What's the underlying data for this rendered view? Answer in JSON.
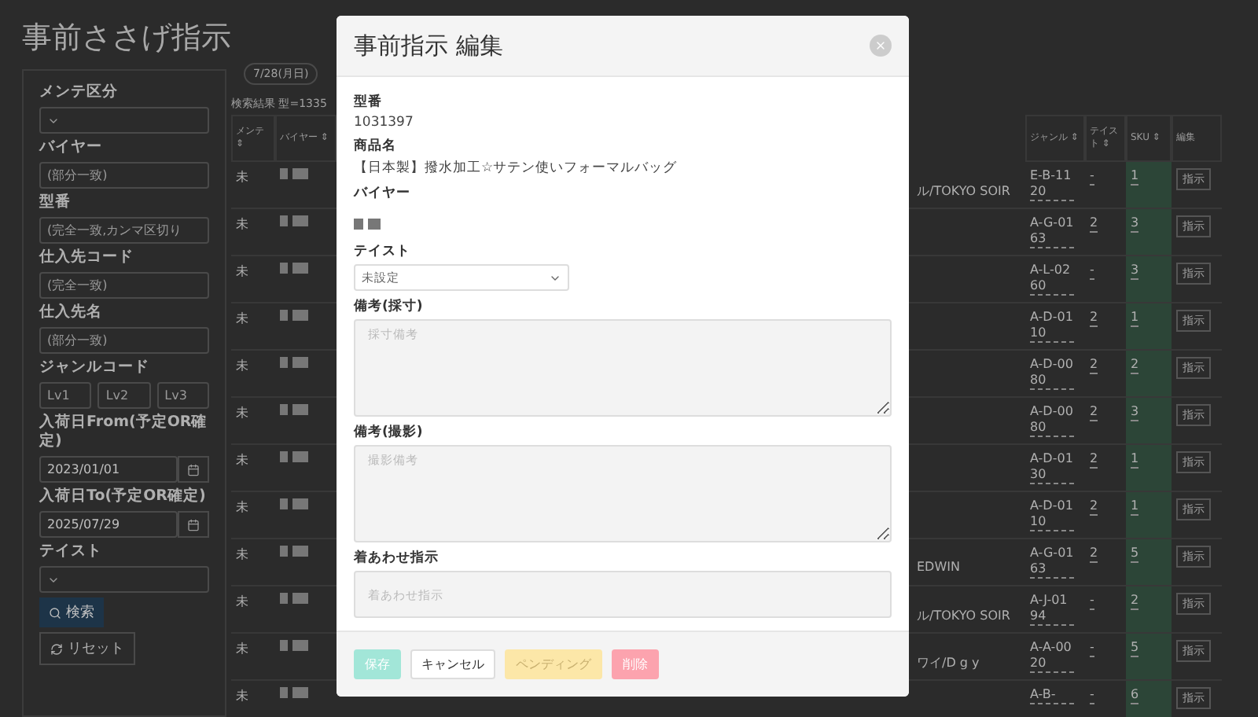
{
  "page": {
    "title": "事前ささげ指示"
  },
  "filters": [
    {
      "kind": "select",
      "label": "メンテ区分"
    },
    {
      "kind": "input",
      "label": "バイヤー",
      "placeholder": "(部分一致)"
    },
    {
      "kind": "input",
      "label": "型番",
      "placeholder": "(完全一致,カンマ区切り"
    },
    {
      "kind": "input",
      "label": "仕入先コード",
      "placeholder": "(完全一致)"
    },
    {
      "kind": "input",
      "label": "仕入先名",
      "placeholder": "(部分一致)"
    },
    {
      "kind": "triple",
      "label": "ジャンルコード",
      "placeholders": [
        "Lv1",
        "Lv2",
        "Lv3"
      ]
    },
    {
      "kind": "date",
      "label": "入荷日From(予定OR確定)",
      "value": "2023/01/01"
    },
    {
      "kind": "date",
      "label": "入荷日To(予定OR確定)",
      "value": "2025/07/29"
    },
    {
      "kind": "select",
      "label": "テイスト"
    }
  ],
  "search_button": "検索",
  "reset_button": "リセット",
  "date_chip": "7/28(月日)",
  "result_summary": "検索結果 型=1335",
  "table": {
    "columns": [
      "メンテ ⇕",
      "バイヤー ⇕",
      "ジャンル ⇕",
      "テイスト ⇕",
      "SKU ⇕",
      "編集"
    ],
    "rows": [
      {
        "maint": "未",
        "brand": "ル/TOKYO SOIR",
        "genre": "E-B-1120",
        "taste": "-",
        "sku": "1",
        "action": "指示"
      },
      {
        "maint": "未",
        "genre": "A-G-0163",
        "taste": "2",
        "sku": "3",
        "action": "指示"
      },
      {
        "maint": "未",
        "genre": "A-L-0260",
        "taste": "-",
        "sku": "3",
        "action": "指示"
      },
      {
        "maint": "未",
        "genre": "A-D-0110",
        "taste": "2",
        "sku": "1",
        "action": "指示"
      },
      {
        "maint": "未",
        "genre": "A-D-0080",
        "taste": "2",
        "sku": "2",
        "action": "指示"
      },
      {
        "maint": "未",
        "genre": "A-D-0080",
        "taste": "2",
        "sku": "3",
        "action": "指示"
      },
      {
        "maint": "未",
        "genre": "A-D-0130",
        "taste": "2",
        "sku": "1",
        "action": "指示"
      },
      {
        "maint": "未",
        "genre": "A-D-0110",
        "taste": "2",
        "sku": "1",
        "action": "指示"
      },
      {
        "maint": "未",
        "brand": "EDWIN",
        "genre": "A-G-0163",
        "taste": "2",
        "sku": "5",
        "action": "指示"
      },
      {
        "maint": "未",
        "brand": "ル/TOKYO SOIR",
        "genre": "A-J-0194",
        "taste": "-",
        "sku": "2",
        "action": "指示"
      },
      {
        "maint": "未",
        "brand": "ワイ/D g y",
        "genre": "A-A-0020",
        "taste": "-",
        "sku": "5",
        "action": "指示"
      },
      {
        "maint": "未",
        "genre": "A-B-",
        "taste": "-",
        "sku": "6",
        "action": "指示"
      }
    ]
  },
  "modal": {
    "title": "事前指示 編集",
    "fields": [
      {
        "kind": "text",
        "label": "型番",
        "value": "1031397"
      },
      {
        "kind": "text",
        "label": "商品名",
        "value": "【日本製】撥水加工☆サテン使いフォーマルバッグ"
      },
      {
        "kind": "blurred",
        "label": "バイヤー"
      },
      {
        "kind": "select",
        "label": "テイスト",
        "value": "未設定"
      },
      {
        "kind": "textarea",
        "label": "備考(採寸)",
        "placeholder": "採寸備考"
      },
      {
        "kind": "textarea",
        "label": "備考(撮影)",
        "placeholder": "撮影備考"
      },
      {
        "kind": "input",
        "label": "着あわせ指示",
        "placeholder": "着あわせ指示"
      }
    ],
    "buttons": [
      {
        "kind": "save",
        "label": "保存"
      },
      {
        "kind": "cancel",
        "label": "キャンセル"
      },
      {
        "kind": "pending",
        "label": "ペンディング"
      },
      {
        "kind": "delete",
        "label": "削除"
      }
    ]
  }
}
